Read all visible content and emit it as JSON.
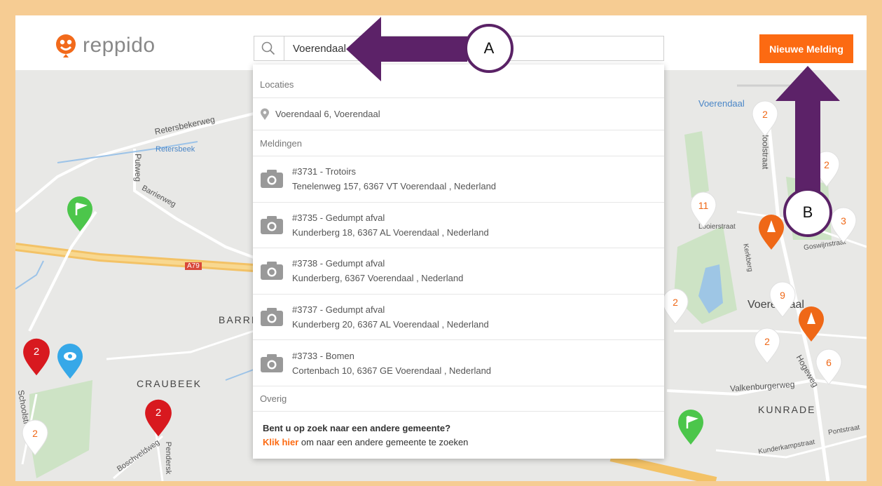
{
  "app": {
    "logo_text": "reppido"
  },
  "search": {
    "value": "Voerendaal"
  },
  "header": {
    "new_button": "Nieuwe Melding"
  },
  "dropdown": {
    "locaties_label": "Locaties",
    "location_result": "Voerendaal 6, Voerendaal",
    "meldingen_label": "Meldingen",
    "meldingen": [
      {
        "title": "#3731 - Trotoirs",
        "address": "Tenelenweg 157, 6367 VT Voerendaal , Nederland"
      },
      {
        "title": "#3735 - Gedumpt afval",
        "address": "Kunderberg 18, 6367 AL Voerendaal , Nederland"
      },
      {
        "title": "#3738 - Gedumpt afval",
        "address": "Kunderberg, 6367 Voerendaal , Nederland"
      },
      {
        "title": "#3737 - Gedumpt afval",
        "address": "Kunderberg 20, 6367 AL Voerendaal , Nederland"
      },
      {
        "title": "#3733 - Bomen",
        "address": "Cortenbach 10, 6367 GE Voerendaal , Nederland"
      }
    ],
    "overig_label": "Overig",
    "other_question": "Bent u op zoek naar een andere gemeente?",
    "other_link": "Klik hier",
    "other_rest": " om naar een andere gemeente te zoeken"
  },
  "annotations": {
    "a": "A",
    "b": "B"
  },
  "map": {
    "labels": {
      "retersbekerweg": "Retersbekerweg",
      "retersbeek": "Retersbeek",
      "putweg": "Putweg",
      "barrierweg": "Barrierweg",
      "a79": "A79",
      "barri": "BARRI",
      "craubeek": "CRAUBEEK",
      "schoolstraat": "Schoolstraat",
      "boschveldweg": "Boschveldweg",
      "penderskoul": "Pendersk",
      "voerendaal_station": "Voerendaal",
      "hoolstraat": "Hoolstraat",
      "voerendaal_town": "Voerendaal",
      "goswijnstraat": "Goswijnstraat",
      "valkenburgerweg": "Valkenburgerweg",
      "kunrade": "KUNRADE",
      "hogeweg": "Hogeweg",
      "kunderkampstraat": "Kunderkampstraat",
      "pontstraat": "Pontstraat",
      "looierstraat": "Looierstraat",
      "kerkberg": "Kerkberg"
    },
    "pins": {
      "p1": "2",
      "p2": "2",
      "p3": "11",
      "p4": "3",
      "p5": "9",
      "p6": "2",
      "p7": "2",
      "p8": "6",
      "p9": "2",
      "p10": "2",
      "p11": "2"
    }
  },
  "colors": {
    "accent": "#fc6a12",
    "annotation": "#5a2266"
  }
}
